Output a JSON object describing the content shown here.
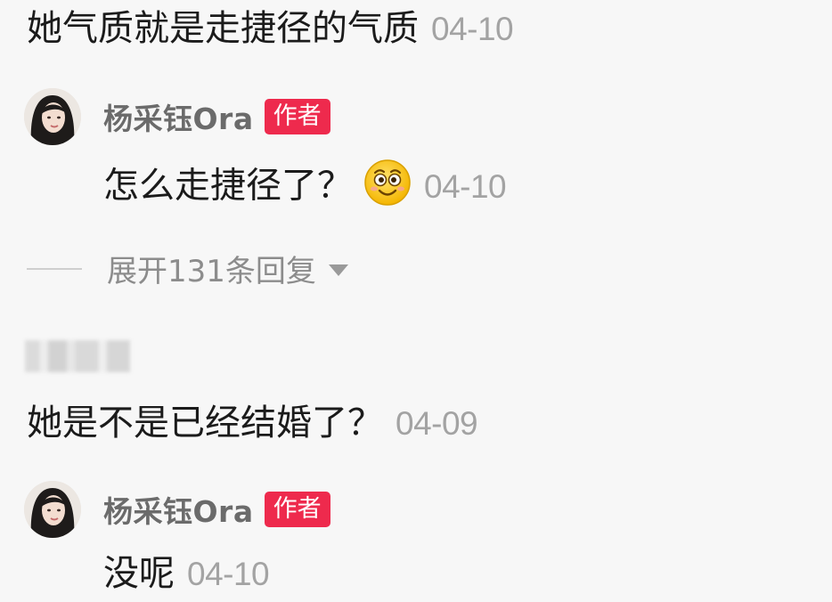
{
  "comments": [
    {
      "text": "她气质就是走捷径的气质",
      "time": "04-10"
    },
    {
      "text": "她是不是已经结婚了？",
      "time": "04-09"
    }
  ],
  "replies": [
    {
      "author": "杨采钰Ora",
      "badge": "作者",
      "text": "怎么走捷径了？",
      "emoji": "smiling-face-emoji",
      "time": "04-10"
    },
    {
      "author": "杨采钰Ora",
      "badge": "作者",
      "text": "没呢",
      "time": "04-10"
    }
  ],
  "expand_replies": {
    "label": "展开131条回复"
  },
  "colors": {
    "background": "#f7f7f7",
    "author_badge": "#ee2a4d",
    "timestamp": "#a3a3a3",
    "author_name": "#6b6b6b"
  },
  "icons": {
    "expand": "chevron-down-icon",
    "avatar": "avatar"
  }
}
